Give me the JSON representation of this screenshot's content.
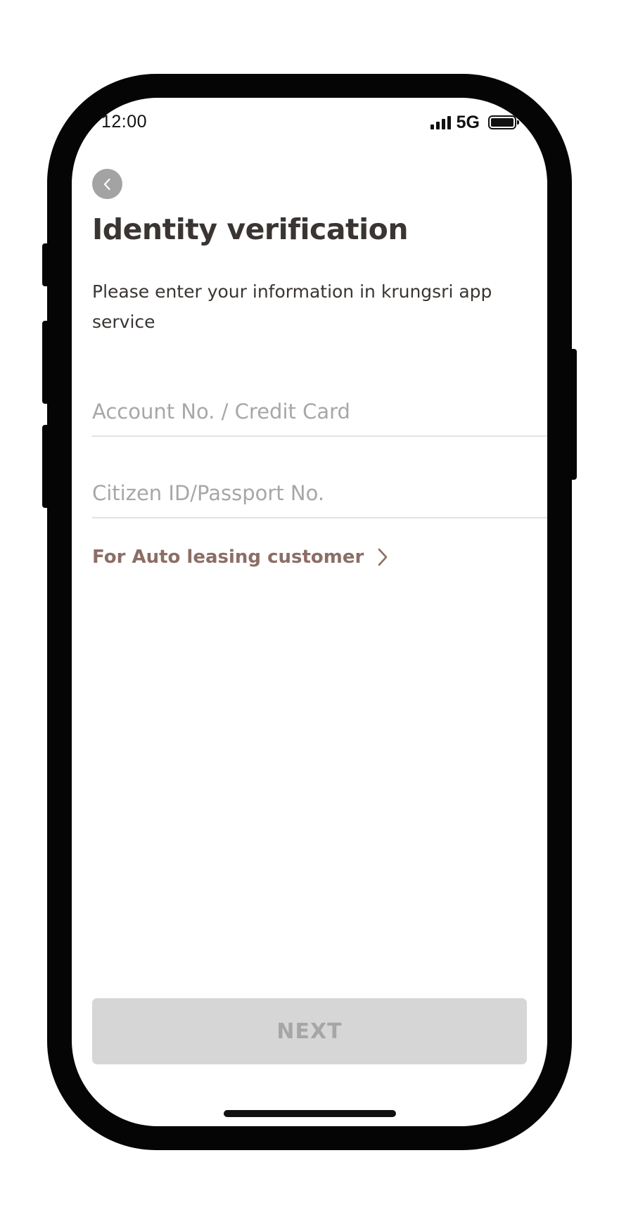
{
  "status_bar": {
    "time": "12:00",
    "network": "5G",
    "icons": [
      "signal-icon",
      "battery-icon"
    ]
  },
  "header": {
    "back_icon": "chevron-left-icon",
    "title": "Identity verification",
    "description": "Please enter your information in krungsri app service"
  },
  "form": {
    "account_placeholder": "Account No. / Credit Card",
    "account_value": "",
    "citizen_placeholder": "Citizen ID/Passport No.",
    "citizen_value": ""
  },
  "links": {
    "auto_leasing_label": "For Auto leasing customer",
    "auto_leasing_icon": "chevron-right-icon"
  },
  "footer": {
    "next_label": "NEXT",
    "next_enabled": false
  },
  "colors": {
    "title_text": "#3a3532",
    "link_accent": "#8b6e66",
    "back_button_bg": "#a3a3a3",
    "disabled_button_bg": "#d6d6d6",
    "disabled_button_text": "#a6a6a6",
    "placeholder_text": "#a7a7a7",
    "divider": "#e2e2e2"
  }
}
